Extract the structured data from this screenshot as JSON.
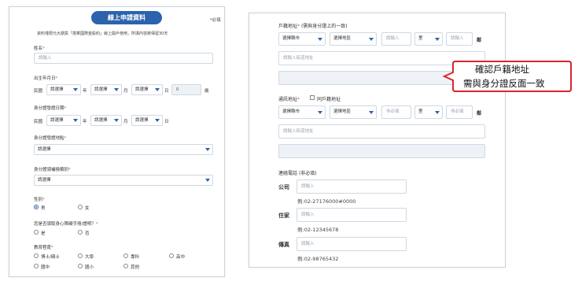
{
  "left": {
    "header": "線上申請資料",
    "required_note": "*必填",
    "notice": "資料僅限元大期貨「搭乘國際金股約」線上開戶使用，所填內容將保留30天",
    "name": {
      "label": "姓名",
      "placeholder": "請輸入"
    },
    "birth": {
      "label": "出生年月日",
      "era": "民國",
      "year_sel": "請選擇",
      "year_unit": "年",
      "month_sel": "請選擇",
      "month_unit": "月",
      "day_sel": "請選擇",
      "day_unit": "日",
      "age_value": "0",
      "age_unit": "歲"
    },
    "id_issue_date": {
      "label": "身分證發證日期",
      "era": "民國",
      "year_sel": "請選擇",
      "year_unit": "年",
      "month_sel": "請選擇",
      "month_unit": "月",
      "day_sel": "請選擇",
      "day_unit": "日"
    },
    "id_issue_place": {
      "label": "身分證發證地點",
      "value": "請選擇"
    },
    "id_issue_type": {
      "label": "身分證領補換類別",
      "value": "請選擇"
    },
    "gender": {
      "label": "性別",
      "options": [
        "男",
        "女"
      ],
      "selected": "男"
    },
    "disability": {
      "label": "您是否領取身心障礙手冊/證明？",
      "options": [
        "是",
        "否"
      ]
    },
    "education": {
      "label": "教育程度",
      "options": [
        "博士/碩士",
        "大學",
        "專科",
        "高中",
        "國中",
        "國小",
        "其他"
      ]
    }
  },
  "right": {
    "household": {
      "label": "戶籍地址",
      "note": "(需與身分證上的一致)",
      "city": "選擇縣市",
      "district": "選擇地區",
      "village": "請輸入",
      "li": "里",
      "lin": "請輸入",
      "lin_unit": "鄰",
      "detail_placeholder": "請輸入街道地址"
    },
    "mailing": {
      "label": "通訊地址",
      "same_label": "同戶籍地址",
      "city": "選擇縣市",
      "district": "選擇地區",
      "village": "非必填",
      "li": "里",
      "lin": "非必填",
      "lin_unit": "鄰",
      "detail_placeholder": "請輸入街道地址"
    },
    "phone": {
      "label": "連絡電話",
      "note": "(非必填)",
      "rows": [
        {
          "label": "公司",
          "placeholder": "請輸入",
          "example": "例:02-27176000#0000"
        },
        {
          "label": "住家",
          "placeholder": "請輸入",
          "example": "例:02-12345678"
        },
        {
          "label": "傳真",
          "placeholder": "請輸入",
          "example": "例:02-98765432"
        }
      ]
    }
  },
  "callout": {
    "line1": "確認戶籍地址",
    "line2": "需與身分證反面一致",
    "border_color": "#d9262e"
  }
}
